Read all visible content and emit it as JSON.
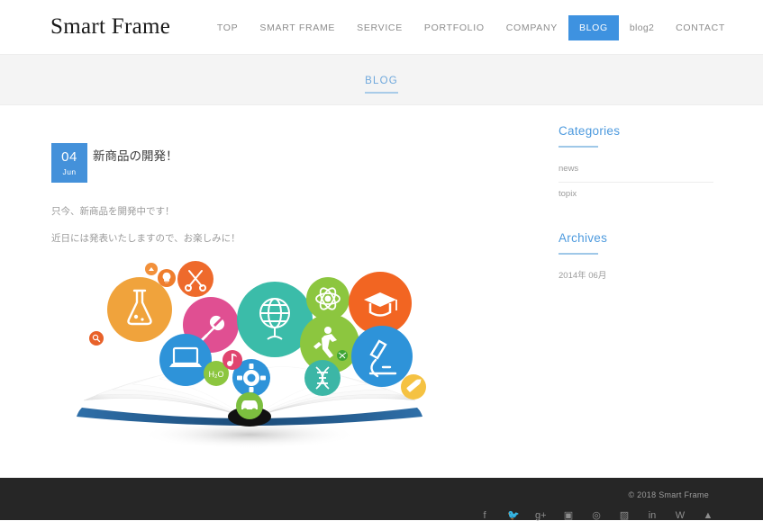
{
  "header": {
    "logo": "Smart Frame",
    "nav": [
      {
        "label": "TOP",
        "active": false,
        "lower": false
      },
      {
        "label": "SMART FRAME",
        "active": false,
        "lower": false
      },
      {
        "label": "SERVICE",
        "active": false,
        "lower": false
      },
      {
        "label": "PORTFOLIO",
        "active": false,
        "lower": false
      },
      {
        "label": "COMPANY",
        "active": false,
        "lower": false
      },
      {
        "label": "BLOG",
        "active": true,
        "lower": false
      },
      {
        "label": "blog2",
        "active": false,
        "lower": true
      },
      {
        "label": "CONTACT",
        "active": false,
        "lower": false
      }
    ]
  },
  "page": {
    "title": "BLOG"
  },
  "post": {
    "date_day": "04",
    "date_month": "Jun",
    "title": "新商品の開発！",
    "paragraphs": [
      "只今、新商品を開発中です！",
      "近日には発表いたしますので、お楽しみに！"
    ]
  },
  "sidebar": {
    "categories": {
      "heading": "Categories",
      "items": [
        "news",
        "topix"
      ]
    },
    "archives": {
      "heading": "Archives",
      "items": [
        "2014年 06月"
      ]
    }
  },
  "footer": {
    "copyright": "© 2018 Smart Frame",
    "social": [
      {
        "name": "facebook-icon",
        "glyph": "f"
      },
      {
        "name": "twitter-icon",
        "glyph": "🐦"
      },
      {
        "name": "google-plus-icon",
        "glyph": "g+"
      },
      {
        "name": "instagram-icon",
        "glyph": "▣"
      },
      {
        "name": "pinterest-icon",
        "glyph": "◎"
      },
      {
        "name": "flickr-icon",
        "glyph": "▨"
      },
      {
        "name": "linkedin-icon",
        "glyph": "in"
      },
      {
        "name": "vk-icon",
        "glyph": "W"
      },
      {
        "name": "dribbble-icon",
        "glyph": "▲"
      }
    ]
  },
  "illustration": {
    "alt": "open book with colorful education icon circles",
    "colors": {
      "orange": "#f0a33c",
      "pink": "#e04f92",
      "teal": "#30b8a4",
      "green": "#8cc63f",
      "deep_orange": "#f26522",
      "blue": "#2e93d9",
      "light_blue": "#4aa3df",
      "yellow": "#f5c242",
      "book_cover": "#1c4d7c"
    },
    "icons": [
      "flask-icon",
      "scissors-icon",
      "plug-icon",
      "globe-icon",
      "atom-icon",
      "graduation-cap-icon",
      "runner-icon",
      "microscope-icon",
      "laptop-icon",
      "gear-icon",
      "dna-icon",
      "h2o-icon",
      "car-icon",
      "pencil-icon",
      "magnifier-icon",
      "music-note-icon",
      "paint-icon",
      "bulb-icon"
    ]
  }
}
